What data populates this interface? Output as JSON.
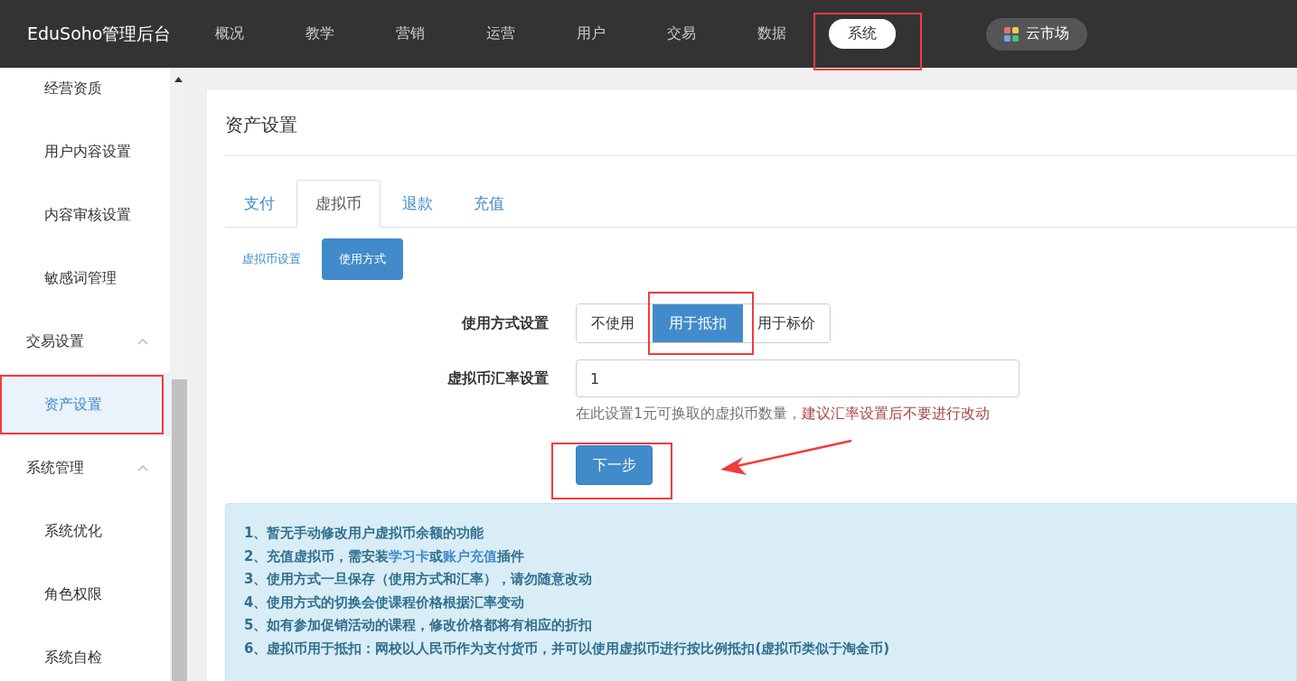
{
  "topbar": {
    "brand": "EduSoho管理后台",
    "nav": [
      {
        "label": "概况",
        "selected": false
      },
      {
        "label": "教学",
        "selected": false
      },
      {
        "label": "营销",
        "selected": false
      },
      {
        "label": "运营",
        "selected": false
      },
      {
        "label": "用户",
        "selected": false
      },
      {
        "label": "交易",
        "selected": false
      },
      {
        "label": "数据",
        "selected": false
      },
      {
        "label": "系统",
        "selected": true
      }
    ],
    "market": "云市场"
  },
  "sidebar": {
    "items": [
      {
        "kind": "item",
        "label": "经营资质",
        "selected": false
      },
      {
        "kind": "item",
        "label": "用户内容设置",
        "selected": false
      },
      {
        "kind": "item",
        "label": "内容审核设置",
        "selected": false
      },
      {
        "kind": "item",
        "label": "敏感词管理",
        "selected": false
      },
      {
        "kind": "group",
        "label": "交易设置",
        "expanded": true
      },
      {
        "kind": "item",
        "label": "资产设置",
        "selected": true
      },
      {
        "kind": "group",
        "label": "系统管理",
        "expanded": true
      },
      {
        "kind": "item",
        "label": "系统优化",
        "selected": false
      },
      {
        "kind": "item",
        "label": "角色权限",
        "selected": false
      },
      {
        "kind": "item",
        "label": "系统自检",
        "selected": false
      }
    ]
  },
  "page": {
    "title": "资产设置",
    "tabs": [
      {
        "label": "支付",
        "selected": false
      },
      {
        "label": "虚拟币",
        "selected": true
      },
      {
        "label": "退款",
        "selected": false
      },
      {
        "label": "充值",
        "selected": false
      }
    ],
    "subtabs": [
      {
        "label": "虚拟币设置",
        "selected": false
      },
      {
        "label": "使用方式",
        "selected": true
      }
    ],
    "form": {
      "mode_label": "使用方式设置",
      "modes": [
        {
          "label": "不使用",
          "selected": false
        },
        {
          "label": "用于抵扣",
          "selected": true
        },
        {
          "label": "用于标价",
          "selected": false
        }
      ],
      "rate_label": "虚拟币汇率设置",
      "rate_value": "1",
      "help": "在此设置1元可换取的虚拟币数量，",
      "warning": "建议汇率设置后不要进行改动",
      "submit": "下一步"
    },
    "notes": [
      [
        {
          "text": "1、暂无手动修改用户虚拟币余额的功能",
          "link": false
        }
      ],
      [
        {
          "text": "2、充值虚拟币，需安装",
          "link": false
        },
        {
          "text": "学习卡",
          "link": true
        },
        {
          "text": "或",
          "link": false
        },
        {
          "text": "账户充值",
          "link": true
        },
        {
          "text": "插件",
          "link": false
        }
      ],
      [
        {
          "text": "3、使用方式一旦保存（使用方式和汇率），请勿随意改动",
          "link": false
        }
      ],
      [
        {
          "text": "4、使用方式的切换会使课程价格根据汇率变动",
          "link": false
        }
      ],
      [
        {
          "text": "5、如有参加促销活动的课程，修改价格都将有相应的折扣",
          "link": false
        }
      ],
      [
        {
          "text": "6、虚拟币用于抵扣：网校以人民币作为支付货币，并可以使用虚拟币进行按比例抵扣(虚拟币类似于淘金币)",
          "link": false
        }
      ]
    ]
  }
}
